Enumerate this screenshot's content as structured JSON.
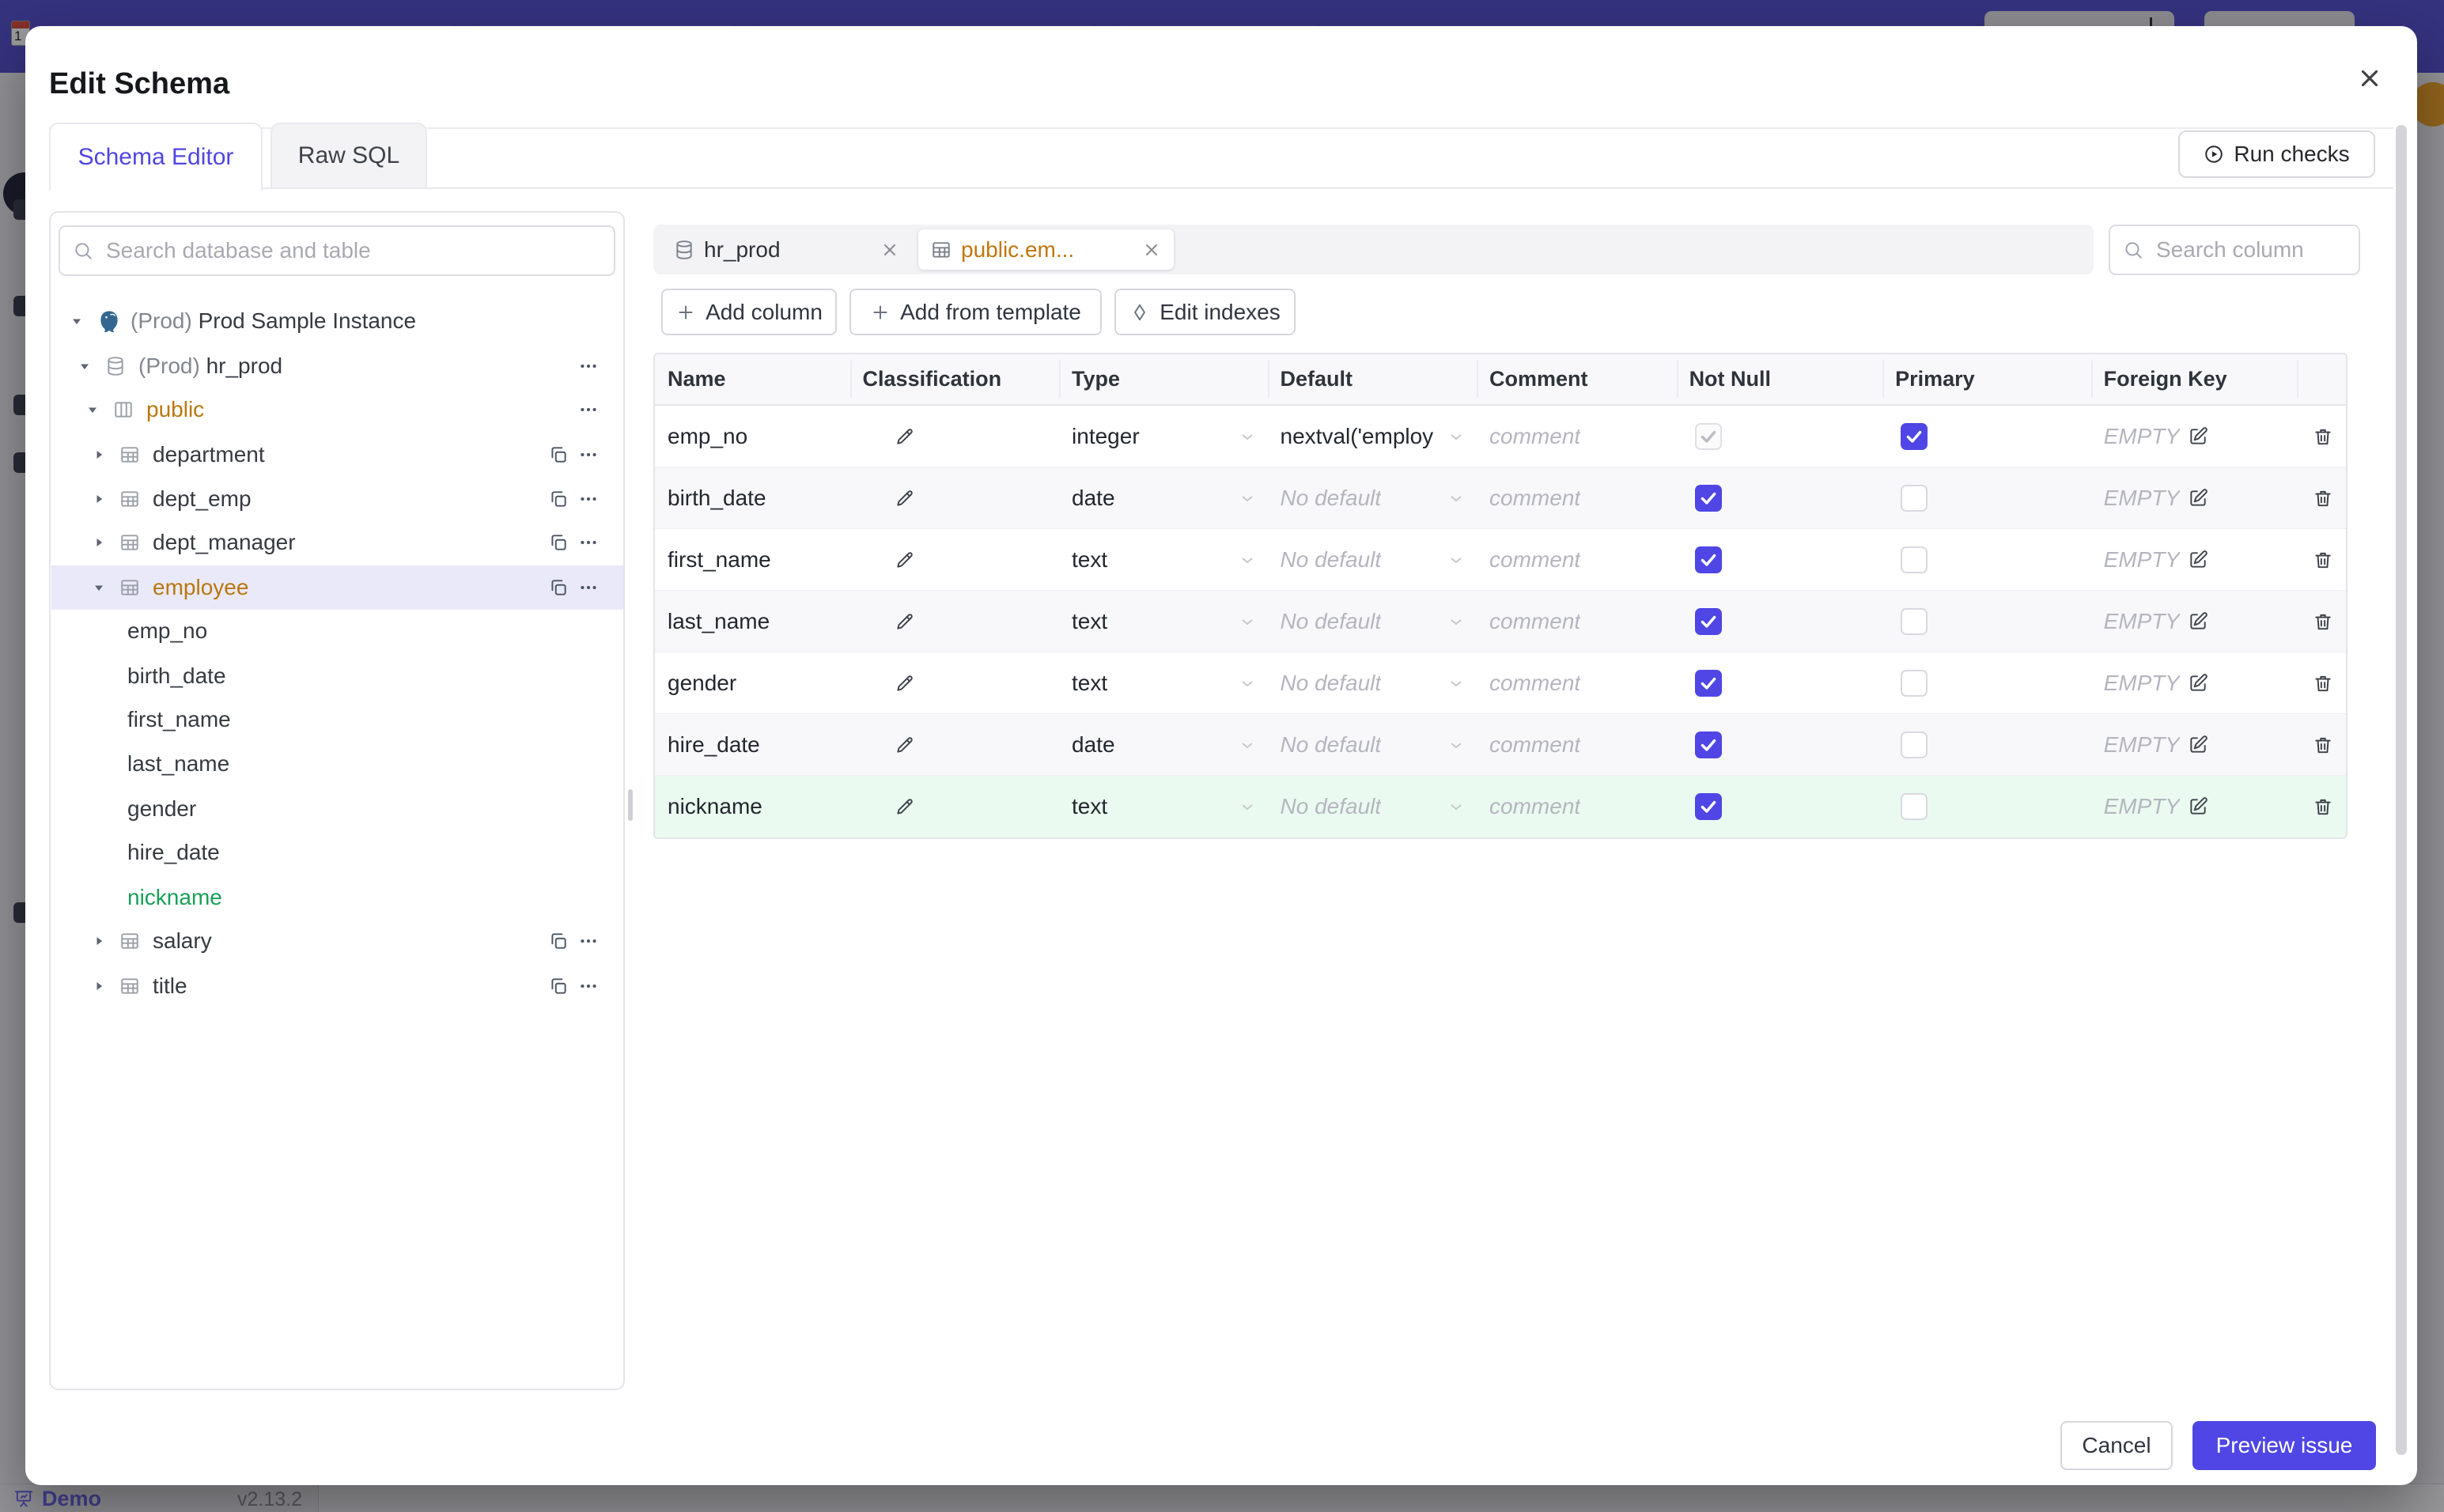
{
  "colors": {
    "accent": "#4f46e5",
    "modified_amber": "#b9770e",
    "new_green": "#18a058",
    "topbar": "#524dcc"
  },
  "modal": {
    "title": "Edit Schema",
    "close_icon": "close-icon",
    "tabs": [
      {
        "label": "Schema Editor",
        "active": true
      },
      {
        "label": "Raw SQL",
        "active": false
      }
    ],
    "run_checks_label": "Run checks",
    "run_checks_icon": "play-circle-icon"
  },
  "sidebar": {
    "search_placeholder": "Search database and table",
    "tree": [
      {
        "label": "Prod Sample Instance",
        "prefix": "(Prod)",
        "icon": "postgres-icon",
        "caret": "expanded",
        "level": 0,
        "actions": []
      },
      {
        "label": "hr_prod",
        "prefix": "(Prod)",
        "icon": "database-icon",
        "caret": "expanded",
        "level": 1,
        "actions": [
          "more"
        ]
      },
      {
        "label": "public",
        "icon": "schema-icon",
        "caret": "expanded",
        "level": 2,
        "state": "modified",
        "actions": [
          "more"
        ]
      },
      {
        "label": "department",
        "icon": "table-icon",
        "caret": "collapsed",
        "level": 3,
        "actions": [
          "copy",
          "more"
        ]
      },
      {
        "label": "dept_emp",
        "icon": "table-icon",
        "caret": "collapsed",
        "level": 3,
        "actions": [
          "copy",
          "more"
        ]
      },
      {
        "label": "dept_manager",
        "icon": "table-icon",
        "caret": "collapsed",
        "level": 3,
        "actions": [
          "copy",
          "more"
        ]
      },
      {
        "label": "employee",
        "icon": "table-icon",
        "caret": "expanded",
        "level": 3,
        "state": "modified",
        "selected": true,
        "actions": [
          "copy",
          "more"
        ]
      },
      {
        "label": "emp_no",
        "level": 4,
        "kind": "column"
      },
      {
        "label": "birth_date",
        "level": 4,
        "kind": "column"
      },
      {
        "label": "first_name",
        "level": 4,
        "kind": "column"
      },
      {
        "label": "last_name",
        "level": 4,
        "kind": "column"
      },
      {
        "label": "gender",
        "level": 4,
        "kind": "column"
      },
      {
        "label": "hire_date",
        "level": 4,
        "kind": "column"
      },
      {
        "label": "nickname",
        "level": 4,
        "kind": "column",
        "state": "new"
      },
      {
        "label": "salary",
        "icon": "table-icon",
        "caret": "collapsed",
        "level": 3,
        "actions": [
          "copy",
          "more"
        ]
      },
      {
        "label": "title",
        "icon": "table-icon",
        "caret": "collapsed",
        "level": 3,
        "actions": [
          "copy",
          "more"
        ]
      }
    ]
  },
  "editor": {
    "tabs": [
      {
        "label": "hr_prod",
        "icon": "database-icon",
        "active": false
      },
      {
        "label": "public.em...",
        "icon": "table-icon",
        "active": true,
        "modified": true
      }
    ],
    "search_placeholder": "Search column",
    "toolbar": [
      {
        "label": "Add column",
        "icon": "plus-icon"
      },
      {
        "label": "Add from template",
        "icon": "plus-icon"
      },
      {
        "label": "Edit indexes",
        "icon": "diamond-icon"
      }
    ],
    "table": {
      "headers": [
        "Name",
        "Classification",
        "Type",
        "Default",
        "Comment",
        "Not Null",
        "Primary",
        "Foreign Key"
      ],
      "rows": [
        {
          "name": "emp_no",
          "type": "integer",
          "default": "nextval('employ",
          "default_is_placeholder": false,
          "comment_placeholder": "comment",
          "not_null": true,
          "not_null_disabled": true,
          "primary": true,
          "foreign_key": "EMPTY"
        },
        {
          "name": "birth_date",
          "type": "date",
          "default": "No default",
          "default_is_placeholder": true,
          "comment_placeholder": "comment",
          "not_null": true,
          "not_null_disabled": false,
          "primary": false,
          "foreign_key": "EMPTY"
        },
        {
          "name": "first_name",
          "type": "text",
          "default": "No default",
          "default_is_placeholder": true,
          "comment_placeholder": "comment",
          "not_null": true,
          "not_null_disabled": false,
          "primary": false,
          "foreign_key": "EMPTY"
        },
        {
          "name": "last_name",
          "type": "text",
          "default": "No default",
          "default_is_placeholder": true,
          "comment_placeholder": "comment",
          "not_null": true,
          "not_null_disabled": false,
          "primary": false,
          "foreign_key": "EMPTY"
        },
        {
          "name": "gender",
          "type": "text",
          "default": "No default",
          "default_is_placeholder": true,
          "comment_placeholder": "comment",
          "not_null": true,
          "not_null_disabled": false,
          "primary": false,
          "foreign_key": "EMPTY"
        },
        {
          "name": "hire_date",
          "type": "date",
          "default": "No default",
          "default_is_placeholder": true,
          "comment_placeholder": "comment",
          "not_null": true,
          "not_null_disabled": false,
          "primary": false,
          "foreign_key": "EMPTY"
        },
        {
          "name": "nickname",
          "type": "text",
          "default": "No default",
          "default_is_placeholder": true,
          "comment_placeholder": "comment",
          "not_null": true,
          "not_null_disabled": false,
          "primary": false,
          "foreign_key": "EMPTY",
          "is_new": true
        }
      ]
    }
  },
  "footer": {
    "cancel_label": "Cancel",
    "primary_label": "Preview issue"
  },
  "background": {
    "demo_label": "Demo",
    "demo_icon": "presentation-icon",
    "version": "v2.13.2",
    "calendar_icon": "calendar-icon",
    "calendar_number": "1"
  }
}
